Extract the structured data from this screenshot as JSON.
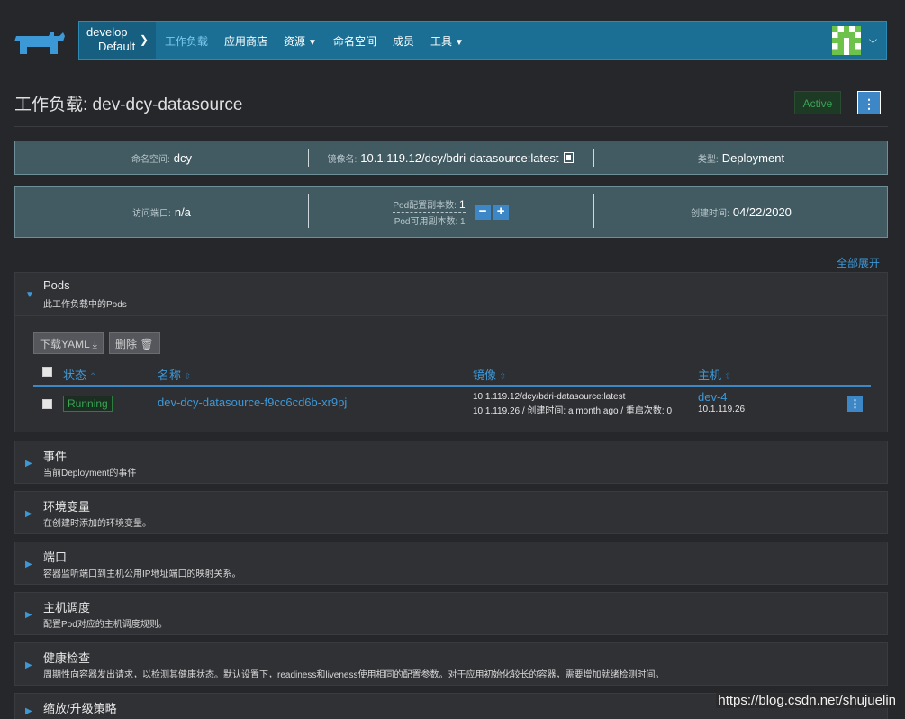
{
  "nav": {
    "cluster": "develop",
    "project": "Default",
    "items": [
      {
        "label": "工作负载",
        "active": true,
        "dropdown": false
      },
      {
        "label": "应用商店",
        "active": false,
        "dropdown": false
      },
      {
        "label": "资源",
        "active": false,
        "dropdown": true
      },
      {
        "label": "命名空间",
        "active": false,
        "dropdown": false
      },
      {
        "label": "成员",
        "active": false,
        "dropdown": false
      },
      {
        "label": "工具",
        "active": false,
        "dropdown": true
      }
    ]
  },
  "header": {
    "title": "工作负载: dev-dcy-datasource",
    "status": "Active",
    "menu": "⋮"
  },
  "info1": {
    "ns_label": "命名空间:",
    "ns_value": "dcy",
    "image_label": "镜像名:",
    "image_value": "10.1.119.12/dcy/bdri-datasource:latest",
    "type_label": "类型:",
    "type_value": "Deployment"
  },
  "info2": {
    "port_label": "访问端口:",
    "port_value": "n/a",
    "config_label": "Pod配置副本数:",
    "config_value": "1",
    "avail_label": "Pod可用副本数: 1",
    "minus": "−",
    "plus": "+",
    "created_label": "创建时间:",
    "created_value": "04/22/2020"
  },
  "expand_all": "全部展开",
  "pods": {
    "title": "Pods",
    "subtitle": "此工作负载中的Pods",
    "download_btn": "下载YAML ⤓",
    "delete_btn": "删除 🗑",
    "columns": {
      "status": "状态",
      "name": "名称",
      "image": "镜像",
      "host": "主机"
    },
    "rows": [
      {
        "status": "Running",
        "name": "dev-dcy-datasource-f9cc6cd6b-xr9pj",
        "image_line1": "10.1.119.12/dcy/bdri-datasource:latest",
        "image_line2": "10.1.119.26 / 创建时间: a month ago / 重启次数: 0",
        "host": "dev-4",
        "host_ip": "10.1.119.26"
      }
    ]
  },
  "sections": [
    {
      "title": "事件",
      "subtitle": "当前Deployment的事件"
    },
    {
      "title": "环境变量",
      "subtitle": "在创建时添加的环境变量。"
    },
    {
      "title": "端口",
      "subtitle": "容器监听端口到主机公用IP地址端口的映射关系。"
    },
    {
      "title": "主机调度",
      "subtitle": "配置Pod对应的主机调度规则。"
    },
    {
      "title": "健康检查",
      "subtitle": "周期性向容器发出请求，以检测其健康状态。默认设置下，readiness和liveness使用相同的配置参数。对于应用初始化较长的容器，需要增加就绪检测时间。"
    },
    {
      "title": "缩放/升级策略",
      "subtitle": ""
    }
  ],
  "watermark": "https://blog.csdn.net/shujuelin",
  "colors": {
    "nav": "#1b6f94",
    "accent": "#3d87c7",
    "link": "#3d98d6",
    "success": "#3aa356",
    "info_bg": "#425b63"
  }
}
